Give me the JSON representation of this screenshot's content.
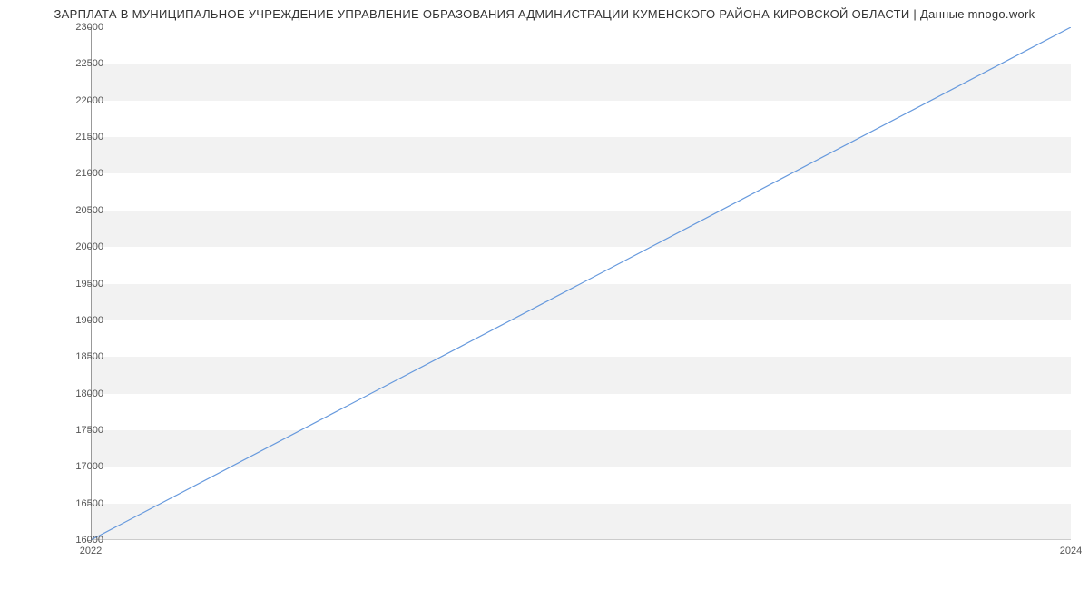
{
  "chart_data": {
    "type": "line",
    "title": "ЗАРПЛАТА В МУНИЦИПАЛЬНОЕ УЧРЕЖДЕНИЕ УПРАВЛЕНИЕ ОБРАЗОВАНИЯ АДМИНИСТРАЦИИ КУМЕНСКОГО РАЙОНА КИРОВСКОЙ ОБЛАСТИ | Данные mnogo.work",
    "x": [
      2022,
      2024
    ],
    "values": [
      16000,
      23000
    ],
    "xlabel": "",
    "ylabel": "",
    "ylim": [
      16000,
      23000
    ],
    "xlim": [
      2022,
      2024
    ],
    "y_ticks": [
      16000,
      16500,
      17000,
      17500,
      18000,
      18500,
      19000,
      19500,
      20000,
      20500,
      21000,
      21500,
      22000,
      22500,
      23000
    ],
    "x_ticks": [
      2022,
      2024
    ],
    "line_color": "#6699dd",
    "grid": true
  }
}
